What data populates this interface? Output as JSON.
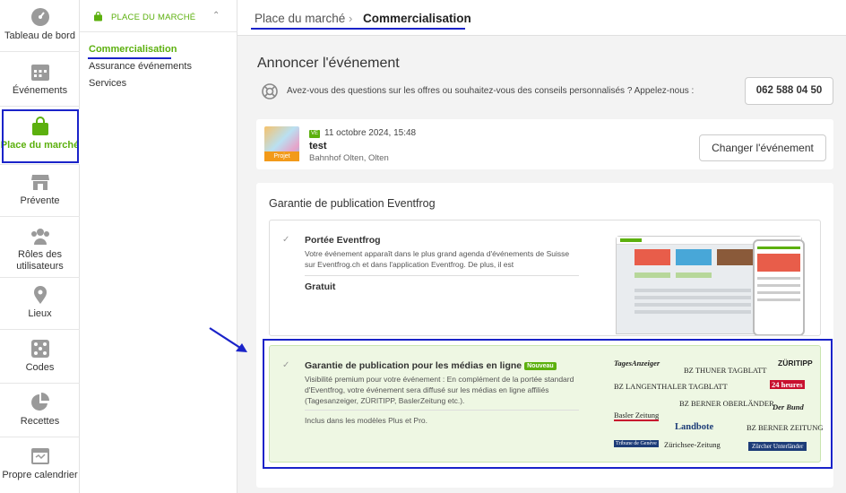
{
  "sidebar": {
    "items": [
      {
        "label": "Tableau de bord",
        "icon": "dashboard-icon"
      },
      {
        "label": "Événements",
        "icon": "calendar-icon"
      },
      {
        "label": "Place du marché",
        "icon": "shopping-bag-icon"
      },
      {
        "label": "Prévente",
        "icon": "store-icon"
      },
      {
        "label": "Rôles des utilisateurs",
        "icon": "users-icon"
      },
      {
        "label": "Lieux",
        "icon": "location-pin-icon"
      },
      {
        "label": "Codes",
        "icon": "dice-icon"
      },
      {
        "label": "Recettes",
        "icon": "pie-chart-icon"
      },
      {
        "label": "Propre calendrier",
        "icon": "browser-calendar-icon"
      }
    ],
    "active_index": 2
  },
  "subnav": {
    "section_title": "PLACE DU MARCHÉ",
    "items": [
      "Commercialisation",
      "Assurance événements",
      "Services"
    ],
    "active_index": 0
  },
  "breadcrumb": {
    "parent": "Place du marché",
    "separator": "›",
    "current": "Commercialisation"
  },
  "page": {
    "title": "Annoncer l'événement",
    "help_text": "Avez-vous des questions sur les offres ou souhaitez-vous des conseils personnalisés ? Appelez-nous :",
    "phone": "062 588 04 50"
  },
  "event": {
    "thumb_tag": "Projet",
    "day_badge": "VE",
    "date": "11 octobre 2024, 15:48",
    "name": "test",
    "location": "Bahnhof Olten, Olten",
    "change_label": "Changer l'événement"
  },
  "guarantee": {
    "title": "Garantie de publication Eventfrog",
    "options": [
      {
        "title": "Portée Eventfrog",
        "description": "Votre événement apparaît dans le plus grand agenda d'événements de Suisse sur Eventfrog.ch et dans l'application Eventfrog. De plus, il est",
        "price": "Gratuit"
      },
      {
        "title": "Garantie de publication pour les médias en ligne",
        "badge": "Nouveau",
        "description": "Visibilité premium pour votre événement : En complément de la portée standard d'Eventfrog, votre événement sera diffusé sur les médias en ligne affiliés (Tagesanzeiger, ZÜRITIPP, BaslerZeitung etc.).",
        "note": "Inclus dans les modèles Plus et Pro."
      }
    ],
    "media_logos": [
      "TagesAnzeiger",
      "BZ THUNER TAGBLATT",
      "ZÜRITIPP",
      "BZ LANGENTHALER TAGBLATT",
      "24 heures",
      "BZ BERNER OBERLÄNDER",
      "Der Bund",
      "Basler Zeitung",
      "Landbote",
      "BZ BERNER ZEITUNG",
      "Tribune de Genève",
      "Zürichsee-Zeitung",
      "Zürcher Unterländer"
    ]
  },
  "colors": {
    "accent": "#5cb00e",
    "annotation": "#1a23c9"
  }
}
